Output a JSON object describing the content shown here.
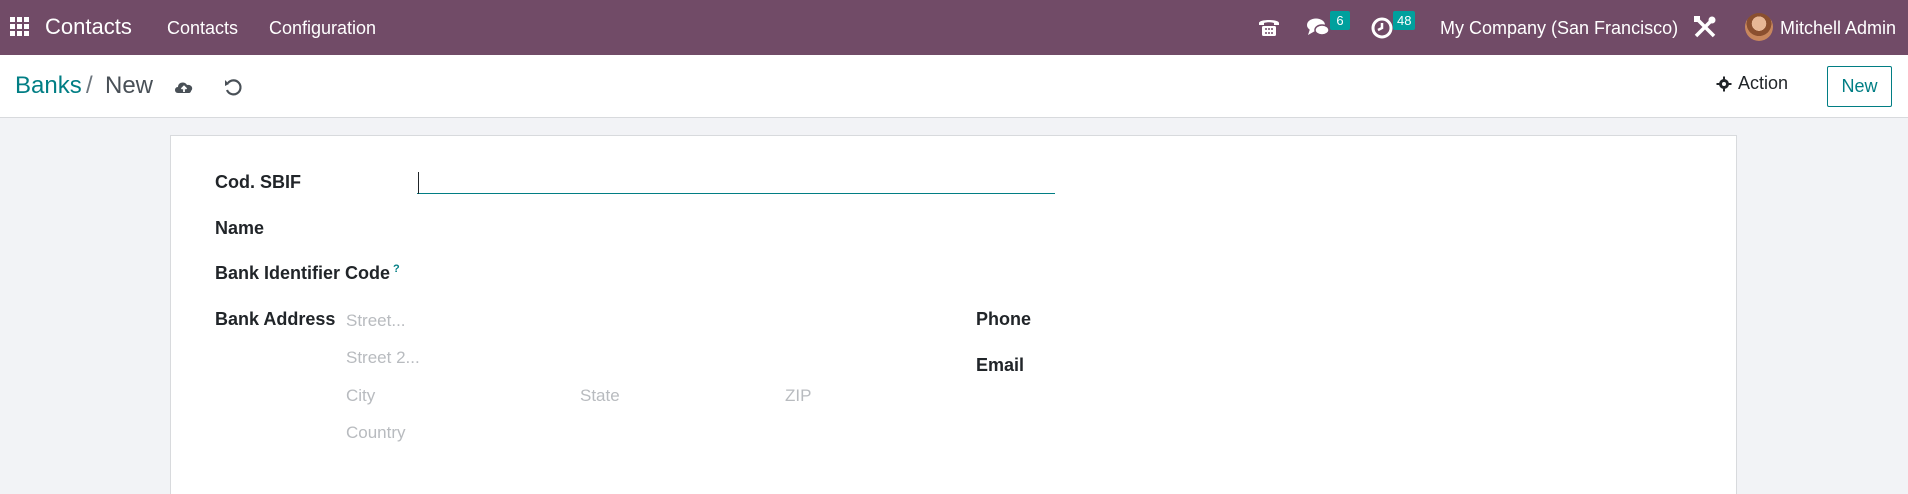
{
  "navbar": {
    "app_name": "Contacts",
    "menu": [
      "Contacts",
      "Configuration"
    ],
    "messages_count": "6",
    "activities_count": "48",
    "company": "My Company (San Francisco)",
    "user": "Mitchell Admin",
    "accent_color": "#714b67",
    "badge_color": "#00a09d"
  },
  "control_panel": {
    "breadcrumb_root": "Banks",
    "breadcrumb_separator": "/",
    "breadcrumb_current": "New",
    "action_label": "Action",
    "new_label": "New"
  },
  "form": {
    "cod_sbif_label": "Cod. SBIF",
    "cod_sbif_value": "",
    "name_label": "Name",
    "bic_label": "Bank Identifier Code",
    "bic_help": "?",
    "address_label": "Bank Address",
    "street_placeholder": "Street...",
    "street2_placeholder": "Street 2...",
    "city_placeholder": "City",
    "state_placeholder": "State",
    "zip_placeholder": "ZIP",
    "country_placeholder": "Country",
    "phone_label": "Phone",
    "email_label": "Email"
  },
  "icons": {
    "apps": "apps-grid-icon",
    "phone": "phone-icon",
    "chat": "chat-icon",
    "activity": "clock-icon",
    "debug": "tools-icon",
    "save": "cloud-upload-icon",
    "discard": "undo-icon",
    "action": "gear-icon"
  }
}
